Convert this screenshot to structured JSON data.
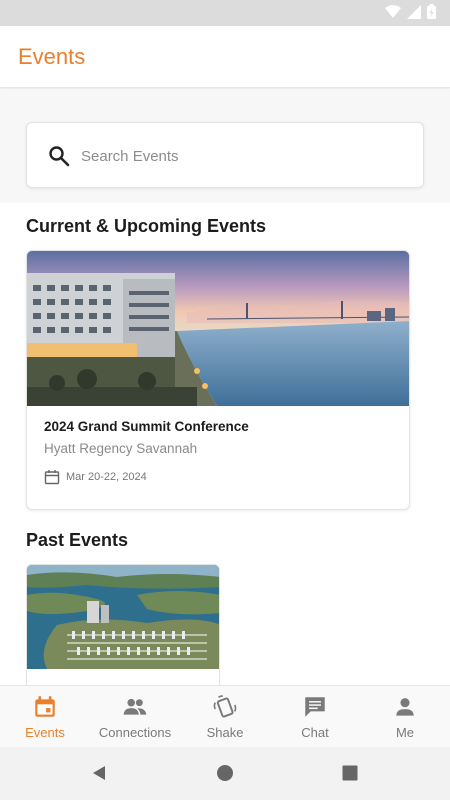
{
  "app_title": "Events",
  "search": {
    "placeholder": "Search Events"
  },
  "sections": {
    "current_title": "Current & Upcoming Events",
    "past_title": "Past Events"
  },
  "current_events": [
    {
      "name": "2024 Grand Summit Conference",
      "venue": "Hyatt Regency Savannah",
      "date": "Mar 20-22, 2024"
    }
  ],
  "bottom_nav": [
    {
      "label": "Events",
      "icon": "calendar-icon",
      "active": true
    },
    {
      "label": "Connections",
      "icon": "people-icon",
      "active": false
    },
    {
      "label": "Shake",
      "icon": "shake-phone-icon",
      "active": false
    },
    {
      "label": "Chat",
      "icon": "chat-bubble-icon",
      "active": false
    },
    {
      "label": "Me",
      "icon": "person-icon",
      "active": false
    }
  ],
  "colors": {
    "accent": "#e8802d",
    "inactive": "#7a7a7a"
  }
}
